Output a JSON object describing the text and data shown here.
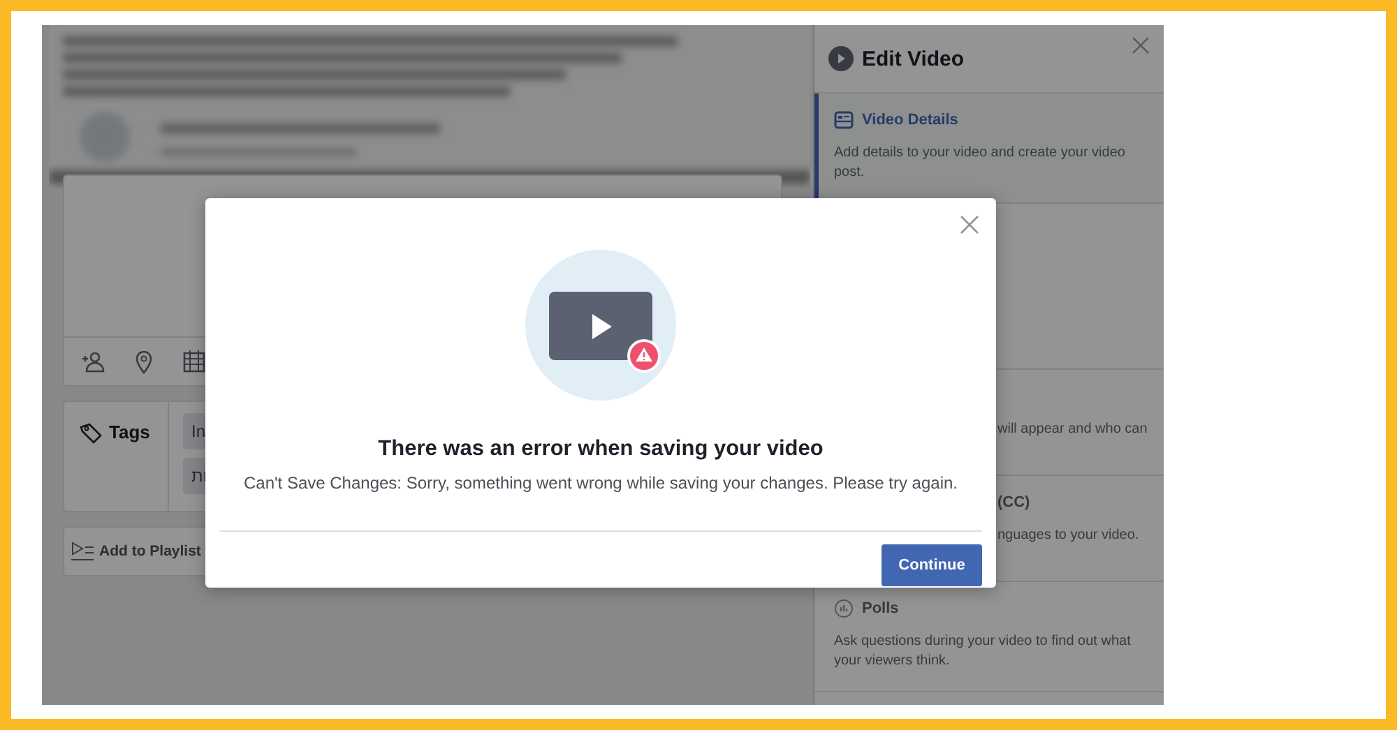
{
  "editor": {
    "tags_label": "Tags",
    "tag_chips": [
      "In",
      "ות"
    ],
    "playlist_label": "Add to Playlist"
  },
  "panel": {
    "title": "Edit Video",
    "sections": [
      {
        "kind": "details",
        "title": "Video Details",
        "description": "Add details to your video and create your video post.",
        "selected": true
      },
      {
        "kind": "spacer"
      },
      {
        "kind": "cut",
        "description": "will appear and who can",
        "selected": false
      },
      {
        "kind": "cut",
        "title": "(CC)",
        "description": "nguages to your video.",
        "selected": false
      },
      {
        "kind": "poll",
        "title": "Polls",
        "description": "Ask questions during your video to find out what your viewers think.",
        "selected": false
      }
    ]
  },
  "dialog": {
    "title": "There was an error when saving your video",
    "message": "Can't Save Changes: Sorry, something went wrong while saving your changes. Please try again.",
    "button": "Continue"
  }
}
